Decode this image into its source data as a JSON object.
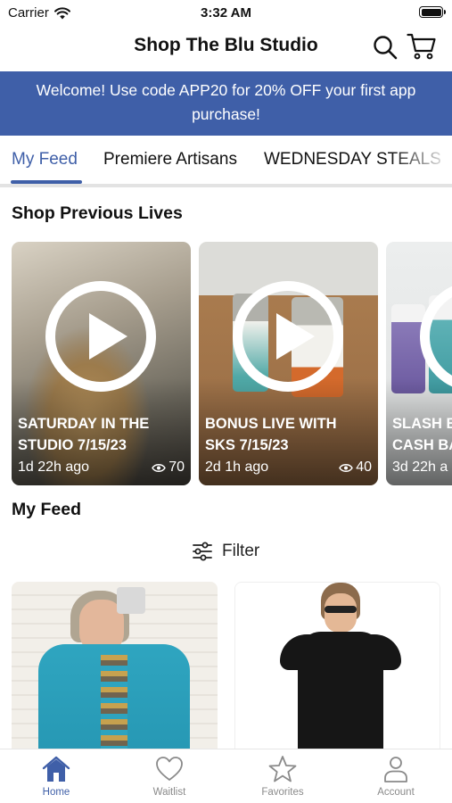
{
  "status_bar": {
    "carrier": "Carrier",
    "time": "3:32 AM"
  },
  "header": {
    "title": "Shop The Blu Studio"
  },
  "promo": {
    "text": "Welcome! Use code APP20 for 20% OFF your first app purchase!"
  },
  "tabs": [
    {
      "label": "My Feed",
      "active": true
    },
    {
      "label": "Premiere Artisans",
      "active": false
    },
    {
      "label": "WEDNESDAY STEALS",
      "active": false
    }
  ],
  "sections": {
    "lives_title": "Shop Previous Lives",
    "feed_title": "My Feed"
  },
  "lives": [
    {
      "title_line1": "SATURDAY IN THE",
      "title_line2": "STUDIO 7/15/23",
      "time": "1d 22h ago",
      "views": "70"
    },
    {
      "title_line1": "BONUS LIVE WITH",
      "title_line2": "SKS 7/15/23",
      "time": "2d 1h ago",
      "views": "40"
    },
    {
      "title_line1": "SLASH B",
      "title_line2": "CASH BA",
      "time": "3d 22h a",
      "views": ""
    }
  ],
  "filter": {
    "label": "Filter"
  },
  "bottom_nav": [
    {
      "label": "Home",
      "icon": "home-icon",
      "active": true
    },
    {
      "label": "Waitlist",
      "icon": "heart-icon",
      "active": false
    },
    {
      "label": "Favorites",
      "icon": "star-icon",
      "active": false
    },
    {
      "label": "Account",
      "icon": "person-icon",
      "active": false
    }
  ],
  "colors": {
    "accent": "#3f5fa8",
    "inactive": "#8a8a8a",
    "divider": "#e3e3e3"
  }
}
